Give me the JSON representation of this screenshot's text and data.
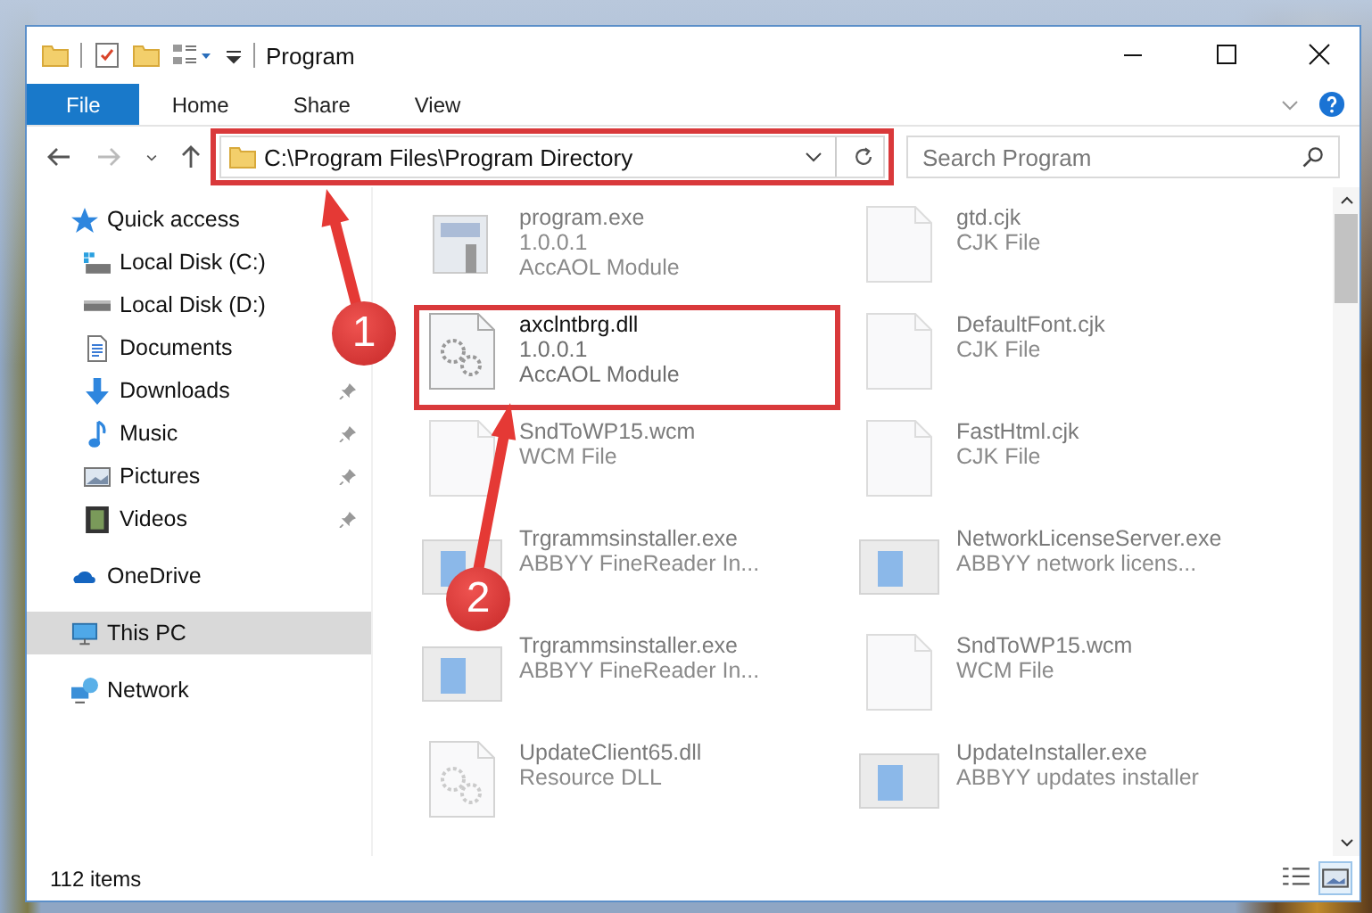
{
  "window": {
    "title": "Program"
  },
  "ribbon": {
    "tabs": [
      {
        "label": "File",
        "selected": true
      },
      {
        "label": "Home",
        "selected": false
      },
      {
        "label": "Share",
        "selected": false
      },
      {
        "label": "View",
        "selected": false
      }
    ]
  },
  "address": {
    "path": "C:\\Program Files\\Program Directory"
  },
  "search": {
    "placeholder": "Search Program"
  },
  "sidebar": {
    "items": [
      {
        "label": "Quick access",
        "kind": "star",
        "selected": false,
        "children": [
          {
            "label": "Local Disk (C:)",
            "kind": "drive-c",
            "pinned": false,
            "selected": false
          },
          {
            "label": "Local Disk (D:)",
            "kind": "drive",
            "pinned": false,
            "selected": false
          },
          {
            "label": "Documents",
            "kind": "document",
            "pinned": false,
            "selected": false
          },
          {
            "label": "Downloads",
            "kind": "download",
            "pinned": true,
            "selected": false
          },
          {
            "label": "Music",
            "kind": "music",
            "pinned": true,
            "selected": false
          },
          {
            "label": "Pictures",
            "kind": "pictures",
            "pinned": true,
            "selected": false
          },
          {
            "label": "Videos",
            "kind": "videos",
            "pinned": true,
            "selected": false
          }
        ]
      },
      {
        "label": "OneDrive",
        "kind": "cloud",
        "selected": false
      },
      {
        "label": "This PC",
        "kind": "pc",
        "selected": true
      },
      {
        "label": "Network",
        "kind": "network",
        "selected": false
      }
    ]
  },
  "files": [
    {
      "name": "program.exe",
      "lines": [
        "1.0.0.1",
        "AccAOL Module"
      ],
      "kind": "app",
      "dimmed": true
    },
    {
      "name": "gtd.cjk",
      "lines": [
        "CJK File"
      ],
      "kind": "blank",
      "dimmed": true
    },
    {
      "name": "axclntbrg.dll",
      "lines": [
        "1.0.0.1",
        "AccAOL Module"
      ],
      "kind": "dll",
      "dimmed": false
    },
    {
      "name": "DefaultFont.cjk",
      "lines": [
        "CJK File"
      ],
      "kind": "blank",
      "dimmed": true
    },
    {
      "name": "SndToWP15.wcm",
      "lines": [
        "WCM File"
      ],
      "kind": "blank",
      "dimmed": true
    },
    {
      "name": "FastHtml.cjk",
      "lines": [
        "CJK File"
      ],
      "kind": "blank",
      "dimmed": true
    },
    {
      "name": "Trgrammsinstaller.exe",
      "lines": [
        "ABBYY FineReader In..."
      ],
      "kind": "installer",
      "dimmed": true
    },
    {
      "name": "NetworkLicenseServer.exe",
      "lines": [
        "ABBYY network licens..."
      ],
      "kind": "installer",
      "dimmed": true
    },
    {
      "name": "Trgrammsinstaller.exe",
      "lines": [
        "ABBYY FineReader In..."
      ],
      "kind": "installer",
      "dimmed": true
    },
    {
      "name": "SndToWP15.wcm",
      "lines": [
        "WCM File"
      ],
      "kind": "blank",
      "dimmed": true
    },
    {
      "name": "UpdateClient65.dll",
      "lines": [
        "Resource DLL"
      ],
      "kind": "dll",
      "dimmed": true
    },
    {
      "name": "UpdateInstaller.exe",
      "lines": [
        "ABBYY updates installer"
      ],
      "kind": "installer",
      "dimmed": true
    }
  ],
  "status_bar": {
    "count": "112 items"
  },
  "annotations": [
    {
      "label": "1"
    },
    {
      "label": "2"
    }
  ]
}
